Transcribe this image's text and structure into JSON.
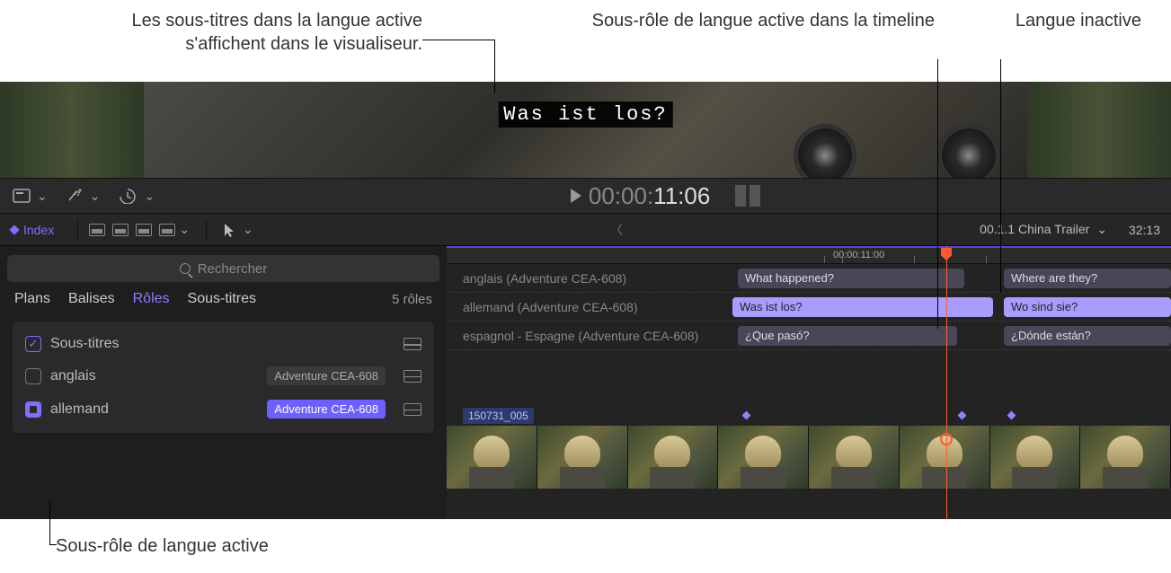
{
  "annotations": {
    "viewer_caption": "Les sous-titres dans la langue active s'affichent dans le visualiseur.",
    "active_subrole": "Sous-rôle de langue active dans la timeline",
    "inactive_lang": "Langue inactive",
    "active_subrole_bottom": "Sous-rôle de langue active"
  },
  "viewer": {
    "caption": "Was ist los?"
  },
  "toolbar": {
    "timecode_dim": "00:00:",
    "timecode_bright": "11:06"
  },
  "toolbar2": {
    "index": "Index",
    "project": "00.1.1 China Trailer",
    "duration": "32:13"
  },
  "index": {
    "search_placeholder": "Rechercher",
    "tabs": {
      "plans": "Plans",
      "balises": "Balises",
      "roles": "Rôles",
      "soustitres": "Sous-titres"
    },
    "count": "5 rôles",
    "roles": {
      "captions_label": "Sous-titres",
      "english": {
        "label": "anglais",
        "badge": "Adventure CEA-608"
      },
      "german": {
        "label": "allemand",
        "badge": "Adventure CEA-608"
      }
    }
  },
  "timeline": {
    "ruler_tc": "00:00:11:00",
    "lanes": {
      "en": {
        "label": "anglais (Adventure CEA-608)",
        "clip1": "What happened?",
        "clip2": "Where are they?"
      },
      "de": {
        "label": "allemand (Adventure CEA-608)",
        "clip1": "Was ist los?",
        "clip2": "Wo sind sie?"
      },
      "es": {
        "label": "espagnol - Espagne (Adventure CEA-608)",
        "clip1": "¿Que pasó?",
        "clip2": "¿Dónde están?"
      }
    },
    "clip_name": "150731_005"
  }
}
